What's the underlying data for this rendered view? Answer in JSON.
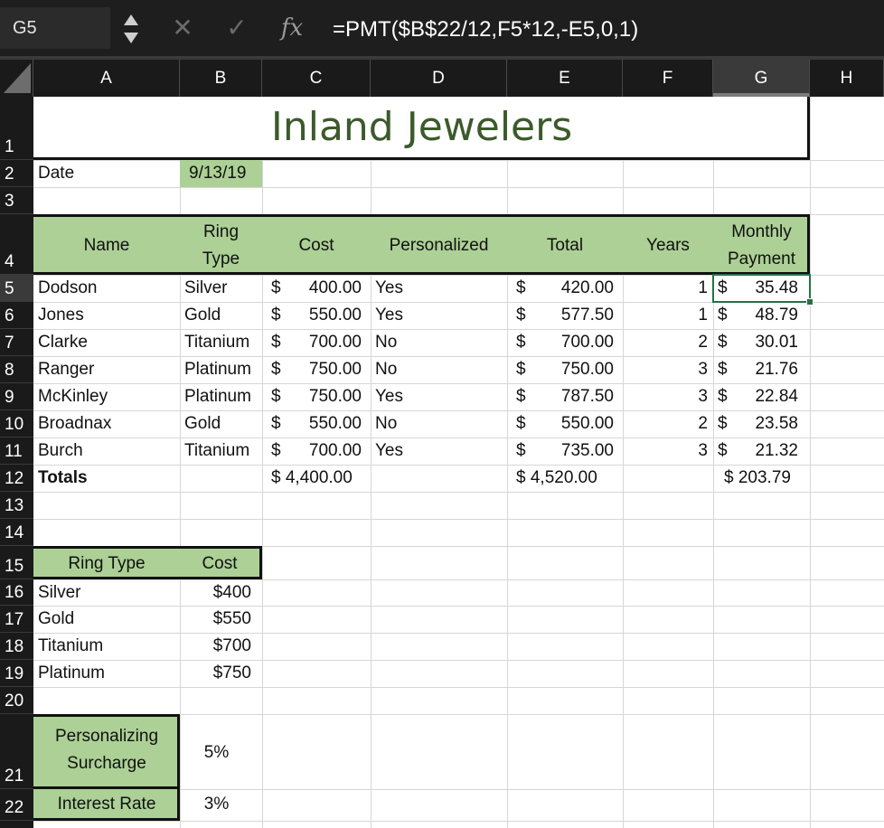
{
  "formula_bar": {
    "name_box": "G5",
    "formula": "=PMT($B$22/12,F5*12,-E5,0,1)",
    "fx_label": "fx",
    "cancel_icon": "✕",
    "enter_icon": "✓"
  },
  "columns": [
    "A",
    "B",
    "C",
    "D",
    "E",
    "F",
    "G",
    "H"
  ],
  "selected_column": "G",
  "rows": [
    "1",
    "2",
    "3",
    "4",
    "5",
    "6",
    "7",
    "8",
    "9",
    "10",
    "11",
    "12",
    "13",
    "14",
    "15",
    "16",
    "17",
    "18",
    "19",
    "20",
    "21",
    "22"
  ],
  "selected_row": "5",
  "sheet": {
    "title": "Inland Jewelers",
    "date_label": "Date",
    "date_value": "9/13/19",
    "headers": {
      "name": "Name",
      "ring_type_1": "Ring",
      "ring_type_2": "Type",
      "cost": "Cost",
      "personalized": "Personalized",
      "total": "Total",
      "years": "Years",
      "monthly_1": "Monthly",
      "monthly_2": "Payment"
    },
    "currency_symbol": "$",
    "customers": [
      {
        "name": "Dodson",
        "type": "Silver",
        "cost": "400.00",
        "personalized": "Yes",
        "total": "420.00",
        "years": "1",
        "payment": "35.48"
      },
      {
        "name": "Jones",
        "type": "Gold",
        "cost": "550.00",
        "personalized": "Yes",
        "total": "577.50",
        "years": "1",
        "payment": "48.79"
      },
      {
        "name": "Clarke",
        "type": "Titanium",
        "cost": "700.00",
        "personalized": "No",
        "total": "700.00",
        "years": "2",
        "payment": "30.01"
      },
      {
        "name": "Ranger",
        "type": "Platinum",
        "cost": "750.00",
        "personalized": "No",
        "total": "750.00",
        "years": "3",
        "payment": "21.76"
      },
      {
        "name": "McKinley",
        "type": "Platinum",
        "cost": "750.00",
        "personalized": "Yes",
        "total": "787.50",
        "years": "3",
        "payment": "22.84"
      },
      {
        "name": "Broadnax",
        "type": "Gold",
        "cost": "550.00",
        "personalized": "No",
        "total": "550.00",
        "years": "2",
        "payment": "23.58"
      },
      {
        "name": "Burch",
        "type": "Titanium",
        "cost": "700.00",
        "personalized": "Yes",
        "total": "735.00",
        "years": "3",
        "payment": "21.32"
      }
    ],
    "totals": {
      "label": "Totals",
      "cost": "$ 4,400.00",
      "total": "$ 4,520.00",
      "payment": "$ 203.79"
    },
    "lookup": {
      "header_type": "Ring Type",
      "header_cost": "Cost",
      "rows": [
        {
          "type": "Silver",
          "cost": "$400"
        },
        {
          "type": "Gold",
          "cost": "$550"
        },
        {
          "type": "Titanium",
          "cost": "$700"
        },
        {
          "type": "Platinum",
          "cost": "$750"
        }
      ]
    },
    "surcharge_label_1": "Personalizing",
    "surcharge_label_2": "Surcharge",
    "surcharge_value": "5%",
    "interest_label": "Interest Rate",
    "interest_value": "3%"
  },
  "colors": {
    "header_fill": "#acd095",
    "title_color": "#3c5a2c",
    "selection": "#217346"
  }
}
